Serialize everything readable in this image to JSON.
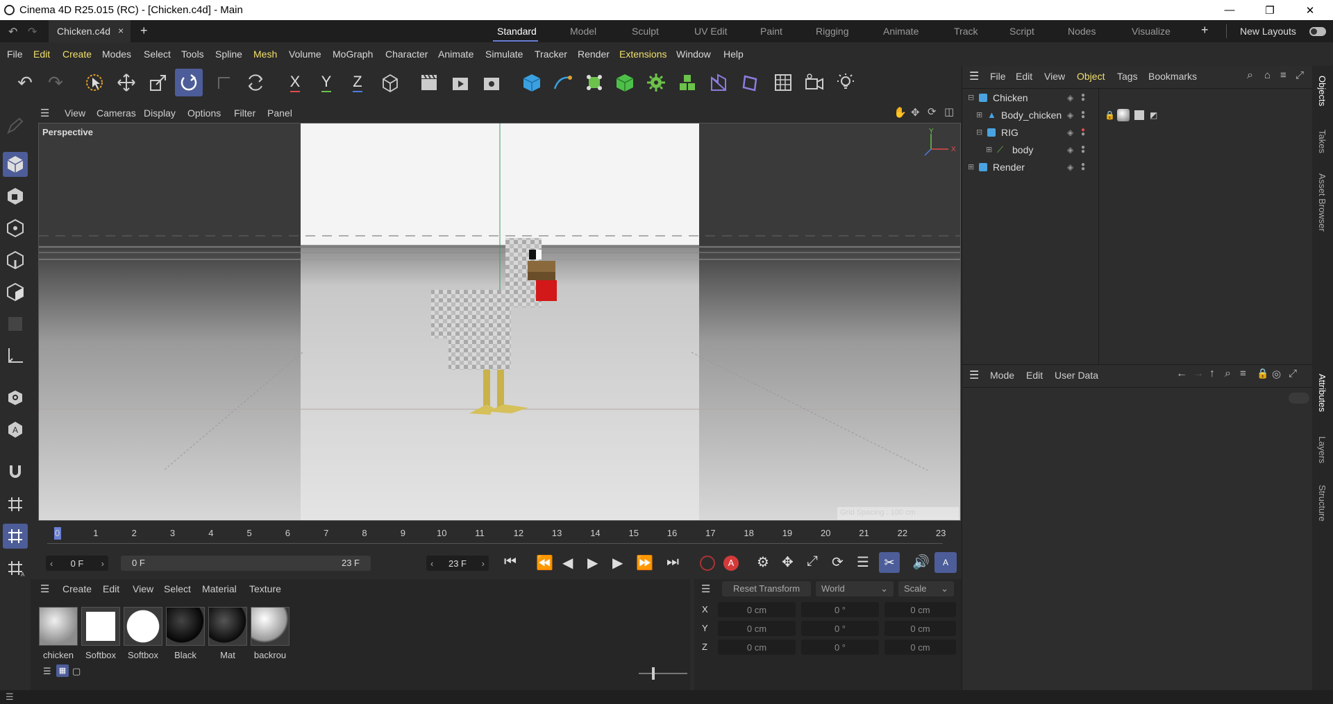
{
  "window": {
    "title": "Cinema 4D R25.015 (RC) - [Chicken.c4d] - Main"
  },
  "doc_tab": {
    "name": "Chicken.c4d",
    "close": "×",
    "add": "+"
  },
  "layouts": {
    "tabs": [
      "Standard",
      "Model",
      "Sculpt",
      "UV Edit",
      "Paint",
      "Rigging",
      "Animate",
      "Track",
      "Script",
      "Nodes",
      "Visualize"
    ],
    "active": "Standard",
    "add": "+",
    "new_layouts": "New Layouts"
  },
  "menu": [
    "File",
    "Edit",
    "Create",
    "Modes",
    "Select",
    "Tools",
    "Spline",
    "Mesh",
    "Volume",
    "MoGraph",
    "Character",
    "Animate",
    "Simulate",
    "Tracker",
    "Render",
    "Extensions",
    "Window",
    "Help"
  ],
  "toolbar_axes": {
    "x": "X",
    "y": "Y",
    "z": "Z"
  },
  "viewport": {
    "menu": [
      "View",
      "Cameras",
      "Display",
      "Options",
      "Filter",
      "Panel"
    ],
    "label": "Perspective",
    "grid_spacing": "Grid Spacing : 100 cm",
    "axis_x": "X",
    "axis_y": "Y"
  },
  "timeline": {
    "ticks": [
      "0",
      "1",
      "2",
      "3",
      "4",
      "5",
      "6",
      "7",
      "8",
      "9",
      "10",
      "11",
      "12",
      "13",
      "14",
      "15",
      "16",
      "17",
      "18",
      "19",
      "20",
      "21",
      "22",
      "23"
    ],
    "current_frame": "0 F",
    "range_start": "0 F",
    "range_end": "23 F",
    "end_frame": "23 F"
  },
  "materials": {
    "menu": [
      "Create",
      "Edit",
      "View",
      "Select",
      "Material",
      "Texture"
    ],
    "items": [
      "chicken",
      "Softbox",
      "Softbox",
      "Black",
      "Mat",
      "backrou"
    ]
  },
  "coordinates": {
    "reset": "Reset Transform",
    "space": "World",
    "mode": "Scale",
    "rows": [
      {
        "axis": "X",
        "pos": "0 cm",
        "rot": "0 °",
        "scale": "0 cm"
      },
      {
        "axis": "Y",
        "pos": "0 cm",
        "rot": "0 °",
        "scale": "0 cm"
      },
      {
        "axis": "Z",
        "pos": "0 cm",
        "rot": "0 °",
        "scale": "0 cm"
      }
    ]
  },
  "objects_panel": {
    "menu": [
      "File",
      "Edit",
      "View",
      "Object",
      "Tags",
      "Bookmarks"
    ],
    "active_menu": "Object",
    "tree": [
      {
        "name": "Chicken",
        "level": 0
      },
      {
        "name": "Body_chicken",
        "level": 1
      },
      {
        "name": "RIG",
        "level": 1
      },
      {
        "name": "body",
        "level": 2
      },
      {
        "name": "Render",
        "level": 0
      }
    ]
  },
  "attributes_panel": {
    "menu": [
      "Mode",
      "Edit",
      "User Data"
    ]
  },
  "right_tabs": [
    "Objects",
    "Takes",
    "Asset Browser",
    "Attributes",
    "Layers",
    "Structure"
  ],
  "colors": {
    "accent": "#4d5d99",
    "highlight_menu": "#f1e06b",
    "axis_x": "#e04b4b",
    "axis_y": "#6cc24a",
    "axis_z": "#4b7de0"
  }
}
